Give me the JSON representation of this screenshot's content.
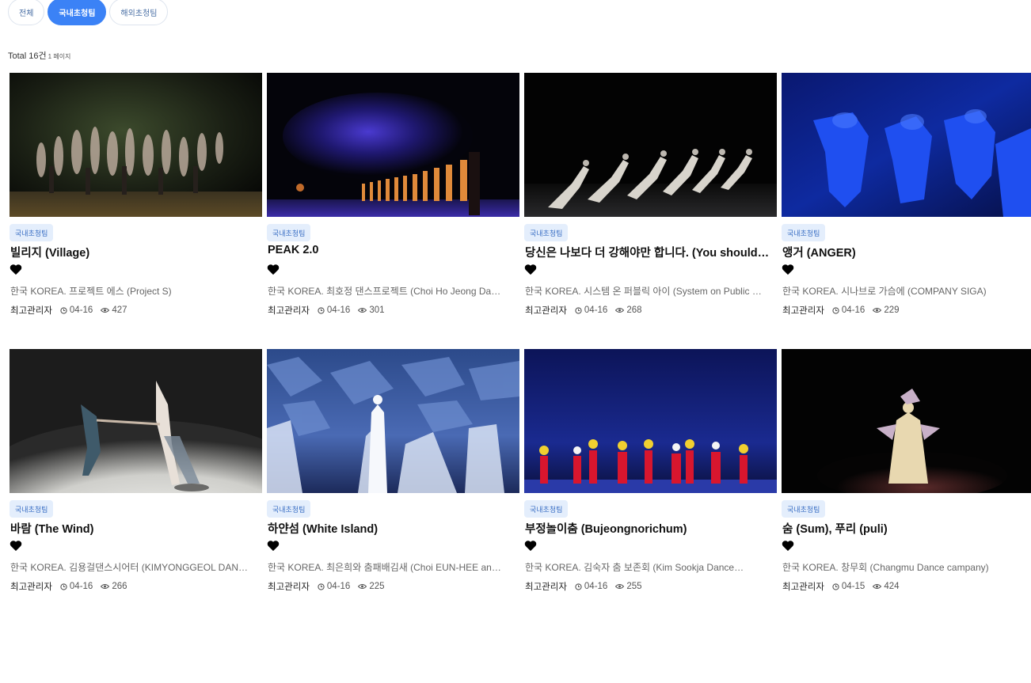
{
  "tabs": [
    {
      "label": "전체",
      "active": false
    },
    {
      "label": "국내초청팀",
      "active": true
    },
    {
      "label": "해외초청팀",
      "active": false
    }
  ],
  "summary": {
    "total": "Total 16건",
    "pages": "1 페이지"
  },
  "cards": [
    {
      "category": "국내초청팀",
      "title": "빌리지 (Village)",
      "company": "한국 KOREA. 프로젝트 에스 (Project S)",
      "author": "최고관리자",
      "date": "04-16",
      "views": "427",
      "image": "dancers-group-dark"
    },
    {
      "category": "국내초청팀",
      "title": "PEAK 2.0",
      "company": "한국 KOREA. 최호정 댄스프로젝트 (Choi Ho Jeong Dance…",
      "author": "최고관리자",
      "date": "04-16",
      "views": "301",
      "image": "dancers-line-blue-smoke"
    },
    {
      "category": "국내초청팀",
      "title": "당신은 나보다 더 강해야만 합니다. (You should be …",
      "company": "한국 KOREA. 시스템 온 퍼블릭 아이 (System on Public Eye)",
      "author": "최고관리자",
      "date": "04-16",
      "views": "268",
      "image": "dancers-lunge-row"
    },
    {
      "category": "국내초청팀",
      "title": "앵거 (ANGER)",
      "company": "한국 KOREA. 시나브로 가슴에 (COMPANY SIGA)",
      "author": "최고관리자",
      "date": "04-16",
      "views": "229",
      "image": "dancers-blue-light"
    },
    {
      "category": "국내초청팀",
      "title": "바람 (The Wind)",
      "company": "한국 KOREA. 김용걸댄스시어터 (KIMYONGGEOL DANCE…",
      "author": "최고관리자",
      "date": "04-16",
      "views": "266",
      "image": "duet-white-floor"
    },
    {
      "category": "국내초청팀",
      "title": "하얀섬 (White Island)",
      "company": "한국 KOREA. 최은희와 춤패배김새 (Choi EUN-HEE and…",
      "author": "최고관리자",
      "date": "04-16",
      "views": "225",
      "image": "veils-blue-rocks"
    },
    {
      "category": "국내초청팀",
      "title": "부정놀이춤 (Bujeongnorichum)",
      "company": "한국 KOREA. 김숙자 춤 보존회 (Kim Sookja Dance…",
      "author": "최고관리자",
      "date": "04-16",
      "views": "255",
      "image": "traditional-red-fans"
    },
    {
      "category": "국내초청팀",
      "title": "숨 (Sum), 푸리 (puli)",
      "company": "한국 KOREA. 창무회 (Changmu Dance campany)",
      "author": "최고관리자",
      "date": "04-15",
      "views": "424",
      "image": "solo-dancer-dark-stage"
    }
  ],
  "colors": {
    "accent": "#3b82f6",
    "badge_bg": "#e4eefc",
    "badge_text": "#3a6fc4"
  },
  "icons": {
    "like": "heart-icon",
    "date": "clock-icon",
    "views": "eye-icon"
  }
}
